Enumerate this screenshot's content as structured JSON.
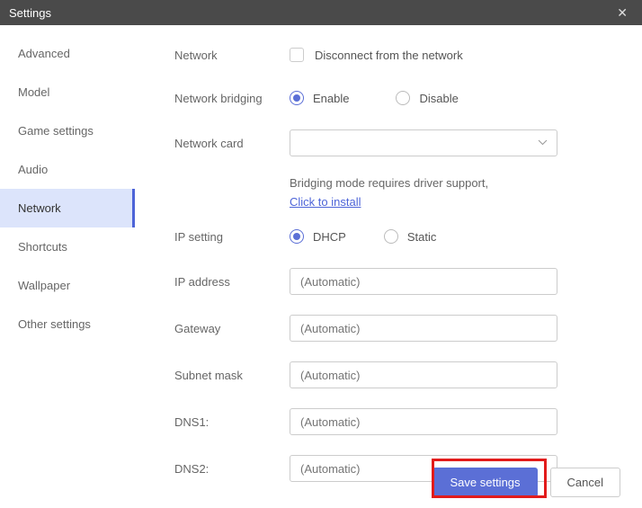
{
  "title": "Settings",
  "sidebar": {
    "items": [
      {
        "label": "Advanced"
      },
      {
        "label": "Model"
      },
      {
        "label": "Game settings"
      },
      {
        "label": "Audio"
      },
      {
        "label": "Network"
      },
      {
        "label": "Shortcuts"
      },
      {
        "label": "Wallpaper"
      },
      {
        "label": "Other settings"
      }
    ],
    "active_index": 4
  },
  "form": {
    "network_label": "Network",
    "disconnect_label": "Disconnect from the network",
    "bridging_label": "Network bridging",
    "bridging_enable": "Enable",
    "bridging_disable": "Disable",
    "card_label": "Network card",
    "info_text": "Bridging mode requires driver support,",
    "install_link": "Click to install",
    "ip_setting_label": "IP setting",
    "dhcp": "DHCP",
    "static": "Static",
    "ip_address_label": "IP address",
    "gateway_label": "Gateway",
    "subnet_label": "Subnet mask",
    "dns1_label": "DNS1:",
    "dns2_label": "DNS2:",
    "auto_placeholder": "(Automatic)"
  },
  "footer": {
    "save": "Save settings",
    "cancel": "Cancel"
  }
}
